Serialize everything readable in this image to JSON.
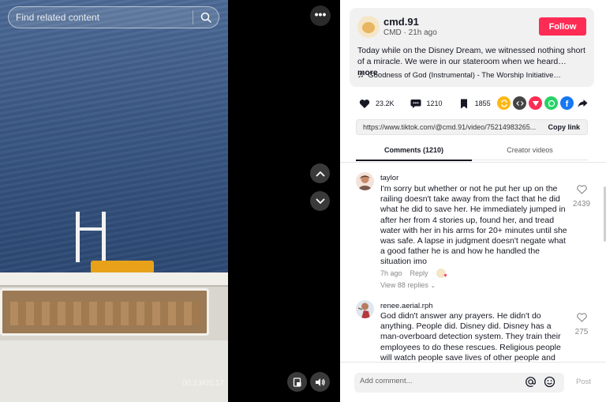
{
  "search": {
    "placeholder": "Find related content",
    "icon": "search-icon"
  },
  "video": {
    "timestamp": "00:13/05:17"
  },
  "post": {
    "author": "cmd.91",
    "subtitle": "CMD · 21h ago",
    "follow_label": "Follow",
    "description": "Today while on the Disney Dream, we witnessed nothing short of a miracle. We were in our stateroom when we heard…",
    "more_label": "more",
    "music": "Goodness of God (Instrumental) - The Worship Initiative…"
  },
  "stats": {
    "likes": "23.2K",
    "comments": "1210",
    "saves": "1855"
  },
  "share_icons": [
    "repost-icon",
    "embed-icon",
    "send-icon",
    "whatsapp-icon",
    "facebook-icon",
    "share-arrow-icon"
  ],
  "colors": {
    "accent": "#fe2c55",
    "repost": "#fcb814",
    "embed": "#444444",
    "send": "#fe2c55",
    "whatsapp": "#25d366",
    "facebook": "#1877f2"
  },
  "link": {
    "url": "https://www.tiktok.com/@cmd.91/video/75214983265...",
    "copy_label": "Copy link"
  },
  "tabs": {
    "comments": "Comments (1210)",
    "creator": "Creator videos"
  },
  "comments": [
    {
      "user": "taylor",
      "text": "I'm sorry but whether or not he put her up on the railing doesn't take away from the fact that he did what he did to save her. He immediately jumped in after her from 4 stories up, found her, and tread water with her in his arms for 20+ minutes until she was safe. A lapse in judgment doesn't negate what a good father he is and how he handled the situation imo",
      "time": "7h ago",
      "reply_label": "Reply",
      "replies": "View 88 replies",
      "likes": "2439"
    },
    {
      "user": "renee.aerial.rph",
      "text": "God didn't answer any prayers. He didn't do anything. People did. Disney did. Disney has a man-overboard detection system. They train their employees to do these rescues. Religious people will watch people save lives of other people and",
      "likes": "275"
    }
  ],
  "composer": {
    "placeholder": "Add comment...",
    "post_label": "Post"
  }
}
